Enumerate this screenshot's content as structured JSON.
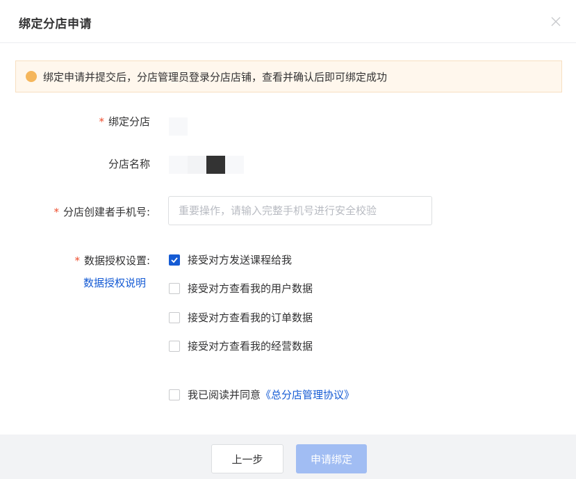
{
  "dialog": {
    "title": "绑定分店申请",
    "close_icon": "close-icon"
  },
  "notice": {
    "icon": "info-dot-icon",
    "text": "绑定申请并提交后，分店管理员登录分店店铺，查看并确认后即可绑定成功"
  },
  "form": {
    "required_mark": "*",
    "branch_label": "绑定分店",
    "branch_name_label": "分店名称",
    "phone_label": "分店创建者手机号:",
    "phone_value": "",
    "phone_placeholder": "重要操作，请输入完整手机号进行安全校验",
    "auth_label": "数据授权设置:",
    "auth_link": "数据授权说明",
    "auth_options": [
      {
        "label": "接受对方发送课程给我",
        "checked": true
      },
      {
        "label": "接受对方查看我的用户数据",
        "checked": false
      },
      {
        "label": "接受对方查看我的订单数据",
        "checked": false
      },
      {
        "label": "接受对方查看我的经营数据",
        "checked": false
      }
    ],
    "agreement_prefix": "我已阅读并同意",
    "agreement_link": "《总分店管理协议》",
    "agreement_checked": false
  },
  "footer": {
    "prev_label": "上一步",
    "submit_label": "申请绑定"
  },
  "colors": {
    "accent": "#155bd4",
    "required": "#ee4d2d",
    "notice_bg": "#fff7ed",
    "notice_icon": "#f5b65c",
    "submit_disabled": "#a1bdf3",
    "footer_bg": "#f2f3f5"
  }
}
